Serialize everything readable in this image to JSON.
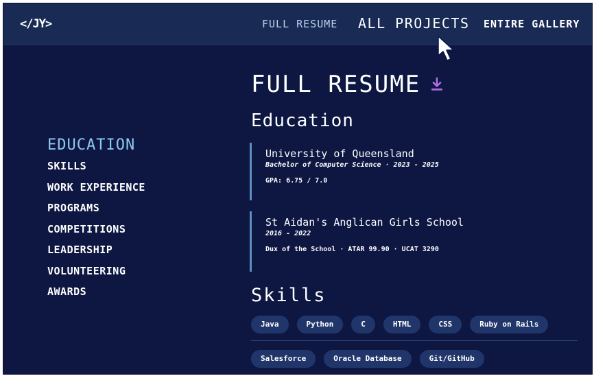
{
  "logo": "</JY>",
  "nav": {
    "full_resume": "FULL RESUME",
    "all_projects": "ALL PROJECTS",
    "entire_gallery": "ENTIRE GALLERY"
  },
  "sidebar": {
    "items": [
      {
        "label": "EDUCATION",
        "active": true
      },
      {
        "label": "SKILLS"
      },
      {
        "label": "WORK EXPERIENCE"
      },
      {
        "label": "PROGRAMS"
      },
      {
        "label": "COMPETITIONS"
      },
      {
        "label": "LEADERSHIP"
      },
      {
        "label": "VOLUNTEERING"
      },
      {
        "label": "AWARDS"
      }
    ]
  },
  "page_title": "FULL RESUME",
  "education": {
    "heading": "Education",
    "entries": [
      {
        "school": "University of Queensland",
        "degree": "Bachelor of Computer Science · 2023 - 2025",
        "detail": "GPA: 6.75 / 7.0"
      },
      {
        "school": "St Aidan's Anglican Girls School",
        "degree": "2016 - 2022",
        "detail": "Dux of the School · ATAR 99.90 · UCAT 3290"
      }
    ]
  },
  "skills": {
    "heading": "Skills",
    "row1": [
      "Java",
      "Python",
      "C",
      "HTML",
      "CSS",
      "Ruby on Rails"
    ],
    "row2": [
      "Salesforce",
      "Oracle Database",
      "Git/GitHub"
    ]
  },
  "icons": {
    "download": "download-icon",
    "cursor": "mouse-cursor-icon"
  },
  "colors": {
    "background": "#0d1742",
    "topbar": "#192b55",
    "accent_active": "#8fc7f1",
    "download_icon": "#b06ee6",
    "chip": "#20366a",
    "timeline": "#5d8fc2"
  }
}
